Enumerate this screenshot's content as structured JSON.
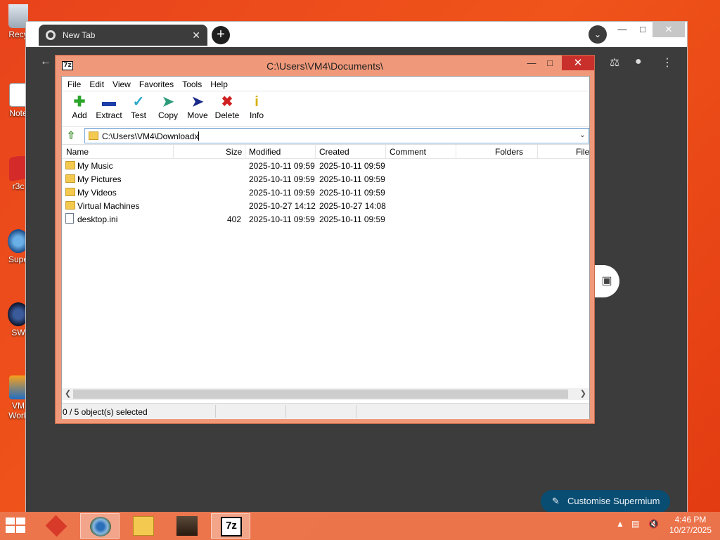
{
  "desktop": {
    "icons": [
      {
        "label": "Recy"
      },
      {
        "label": "Note"
      },
      {
        "label": "r3c"
      },
      {
        "label": "Supe"
      },
      {
        "label": "SW"
      },
      {
        "label": "VM Work"
      }
    ]
  },
  "browser": {
    "tab_title": "New Tab",
    "tab_close": "✕",
    "new_tab": "+",
    "customise_label": "Customise Supermium"
  },
  "zip": {
    "title": "C:\\Users\\VM4\\Documents\\",
    "logo": "7z",
    "menu": [
      "File",
      "Edit",
      "View",
      "Favorites",
      "Tools",
      "Help"
    ],
    "toolbar": [
      {
        "label": "Add",
        "icon": "plus-icon",
        "color": "#2aa52a"
      },
      {
        "label": "Extract",
        "icon": "minus-icon",
        "color": "#1f3fa8"
      },
      {
        "label": "Test",
        "icon": "check-icon",
        "color": "#2aa8c8"
      },
      {
        "label": "Copy",
        "icon": "copy-arrow-icon",
        "color": "#2a9a7a"
      },
      {
        "label": "Move",
        "icon": "move-arrow-icon",
        "color": "#1a2a8a"
      },
      {
        "label": "Delete",
        "icon": "delete-x-icon",
        "color": "#d02020"
      },
      {
        "label": "Info",
        "icon": "info-icon",
        "color": "#d8b000"
      }
    ],
    "address": "C:\\Users\\VM4\\Downloadx",
    "columns": {
      "name": "Name",
      "size": "Size",
      "modified": "Modified",
      "created": "Created",
      "comment": "Comment",
      "folders": "Folders",
      "files": "File"
    },
    "rows": [
      {
        "name": "My Music",
        "size": "",
        "modified": "2025-10-11 09:59",
        "created": "2025-10-11 09:59",
        "type": "folder"
      },
      {
        "name": "My Pictures",
        "size": "",
        "modified": "2025-10-11 09:59",
        "created": "2025-10-11 09:59",
        "type": "folder"
      },
      {
        "name": "My Videos",
        "size": "",
        "modified": "2025-10-11 09:59",
        "created": "2025-10-11 09:59",
        "type": "folder"
      },
      {
        "name": "Virtual Machines",
        "size": "",
        "modified": "2025-10-27 14:12",
        "created": "2025-10-27 14:08",
        "type": "folder"
      },
      {
        "name": "desktop.ini",
        "size": "402",
        "modified": "2025-10-11 09:59",
        "created": "2025-10-11 09:59",
        "type": "file"
      }
    ],
    "status": "0 / 5 object(s) selected"
  },
  "taskbar": {
    "time": "4:46 PM",
    "date": "10/27/2025",
    "apps": [
      "app-1",
      "browser",
      "file-explorer",
      "app-4",
      "7-zip"
    ],
    "seven_zip_label": "7z"
  }
}
